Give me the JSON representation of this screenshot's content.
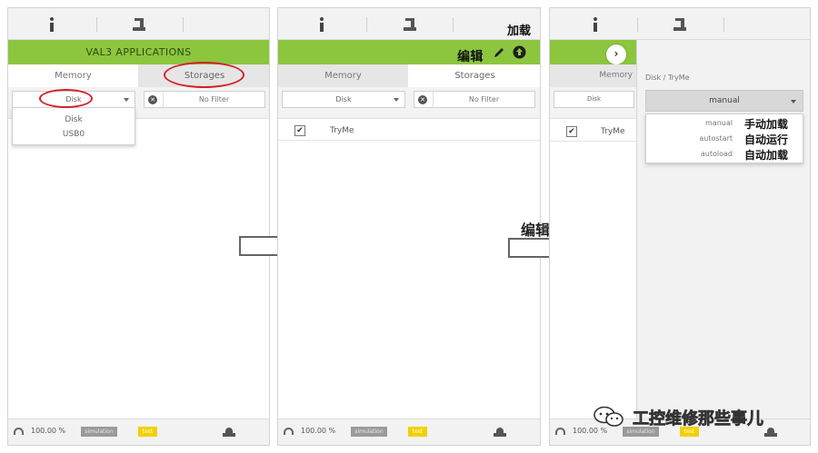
{
  "panel1": {
    "title": "VAL3 APPLICATIONS",
    "tabs": [
      "Memory",
      "Storages"
    ],
    "storage_select": "Disk",
    "filter_placeholder": "No Filter",
    "dropdown_options": [
      "Disk",
      "USB0"
    ],
    "speed": "100.00 %",
    "simulation": "simulation",
    "mode": "test"
  },
  "panel2": {
    "tabs": [
      "Memory",
      "Storages"
    ],
    "storage_select": "Disk",
    "filter_placeholder": "No Filter",
    "edit_label": "编辑",
    "load_label": "加载",
    "app_name": "TryMe",
    "speed": "100.00 %",
    "simulation": "simulation",
    "mode": "test"
  },
  "panel3": {
    "tab_memory": "Memory",
    "storage_select": "Disk",
    "breadcrumb": "Disk / TryMe",
    "mode_select": "manual",
    "app_name": "TryMe",
    "options": [
      {
        "value": "manual",
        "label": "手动加载"
      },
      {
        "value": "autostart",
        "label": "自动运行"
      },
      {
        "value": "autoload",
        "label": "自动加载"
      }
    ],
    "speed": "100.00 %",
    "simulation": "simulation",
    "mode": "test"
  },
  "between_caption": "编辑",
  "watermark": "工控维修那些事儿",
  "colors": {
    "accent_green": "#8cc63f",
    "annotation_red": "#d3222a",
    "mode_yellow": "#f2d000"
  }
}
